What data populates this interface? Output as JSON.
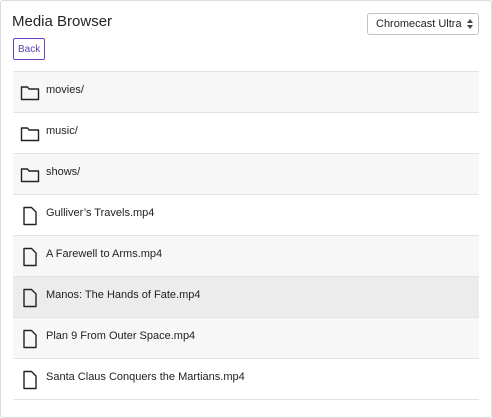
{
  "title": "Media Browser",
  "device_select": {
    "selected": "Chromecast Ultra"
  },
  "back_label": "Back",
  "items": [
    {
      "type": "folder",
      "label": "movies/",
      "icon": "folder-icon"
    },
    {
      "type": "folder",
      "label": "music/",
      "icon": "folder-icon"
    },
    {
      "type": "folder",
      "label": "shows/",
      "icon": "folder-icon"
    },
    {
      "type": "file",
      "label": "Gulliver’s Travels.mp4",
      "icon": "file-icon"
    },
    {
      "type": "file",
      "label": "A Farewell to Arms.mp4",
      "icon": "file-icon"
    },
    {
      "type": "file",
      "label": "Manos: The Hands of Fate.mp4",
      "icon": "file-icon",
      "highlighted": true
    },
    {
      "type": "file",
      "label": "Plan 9 From Outer Space.mp4",
      "icon": "file-icon"
    },
    {
      "type": "file",
      "label": "Santa Claus Conquers the Martians.mp4",
      "icon": "file-icon"
    }
  ]
}
